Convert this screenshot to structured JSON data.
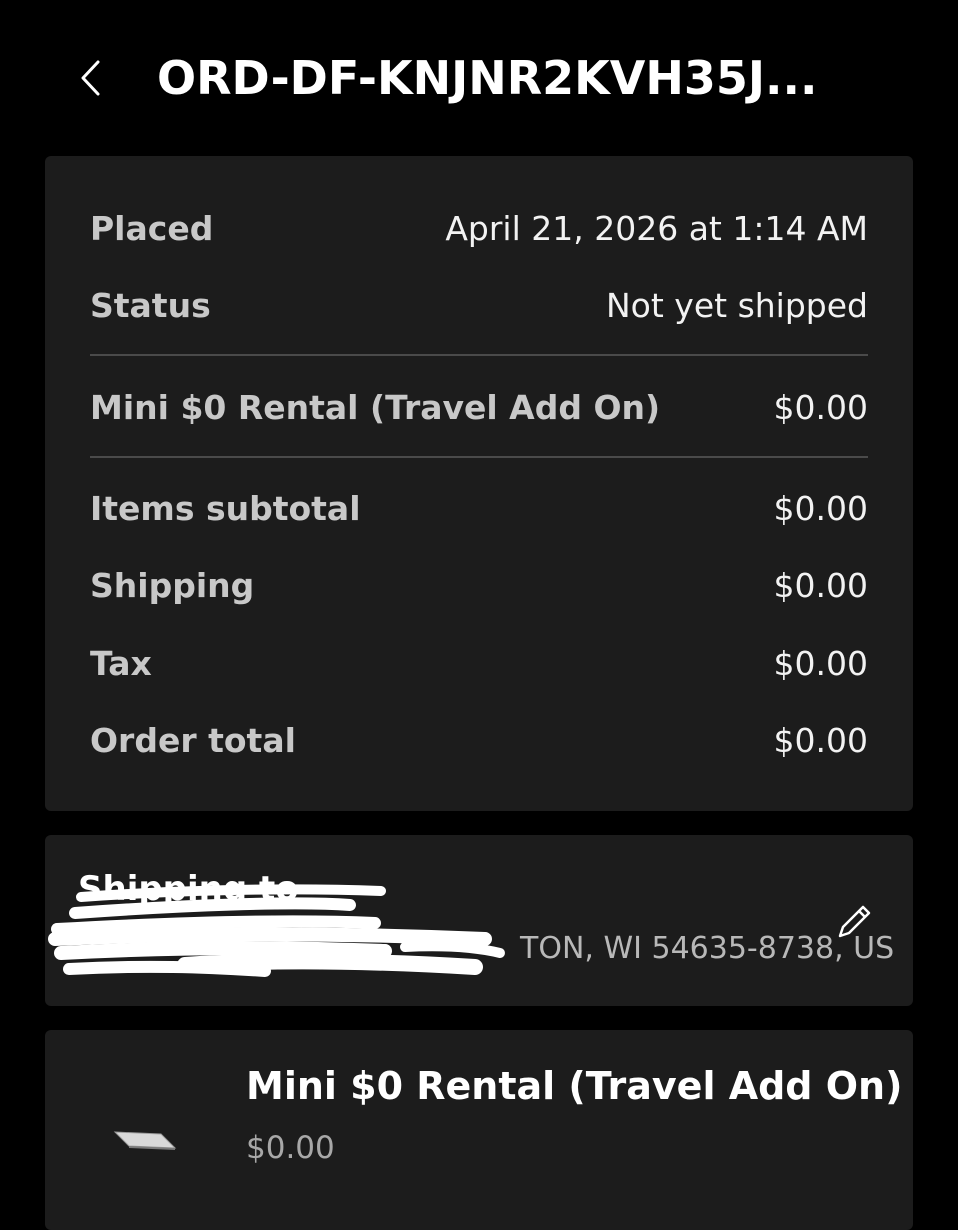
{
  "header": {
    "title": "ORD-DF-KNJNR2KVH35J...",
    "back_icon": "chevron-left-icon"
  },
  "summary": {
    "placed_label": "Placed",
    "placed_value": "April 21, 2026 at 1:14 AM",
    "status_label": "Status",
    "status_value": "Not yet shipped",
    "line_item_name": "Mini $0 Rental (Travel Add On)",
    "line_item_price": "$0.00",
    "subtotal_label": "Items subtotal",
    "subtotal_value": "$0.00",
    "shipping_label": "Shipping",
    "shipping_value": "$0.00",
    "tax_label": "Tax",
    "tax_value": "$0.00",
    "total_label": "Order total",
    "total_value": "$0.00"
  },
  "shipping": {
    "label": "Shipping to",
    "address_visible": "TON, WI 54635-8738, US",
    "edit_icon": "pencil-icon"
  },
  "item": {
    "name": "Mini $0 Rental (Travel Add On)",
    "price": "$0.00",
    "thumbnail_icon": "device-thumbnail"
  },
  "colors": {
    "background": "#000000",
    "card": "#1c1c1c",
    "divider": "#4a4a4a",
    "label": "#c8c8c8",
    "value": "#f2f2f2",
    "muted": "#a8a8a8"
  }
}
